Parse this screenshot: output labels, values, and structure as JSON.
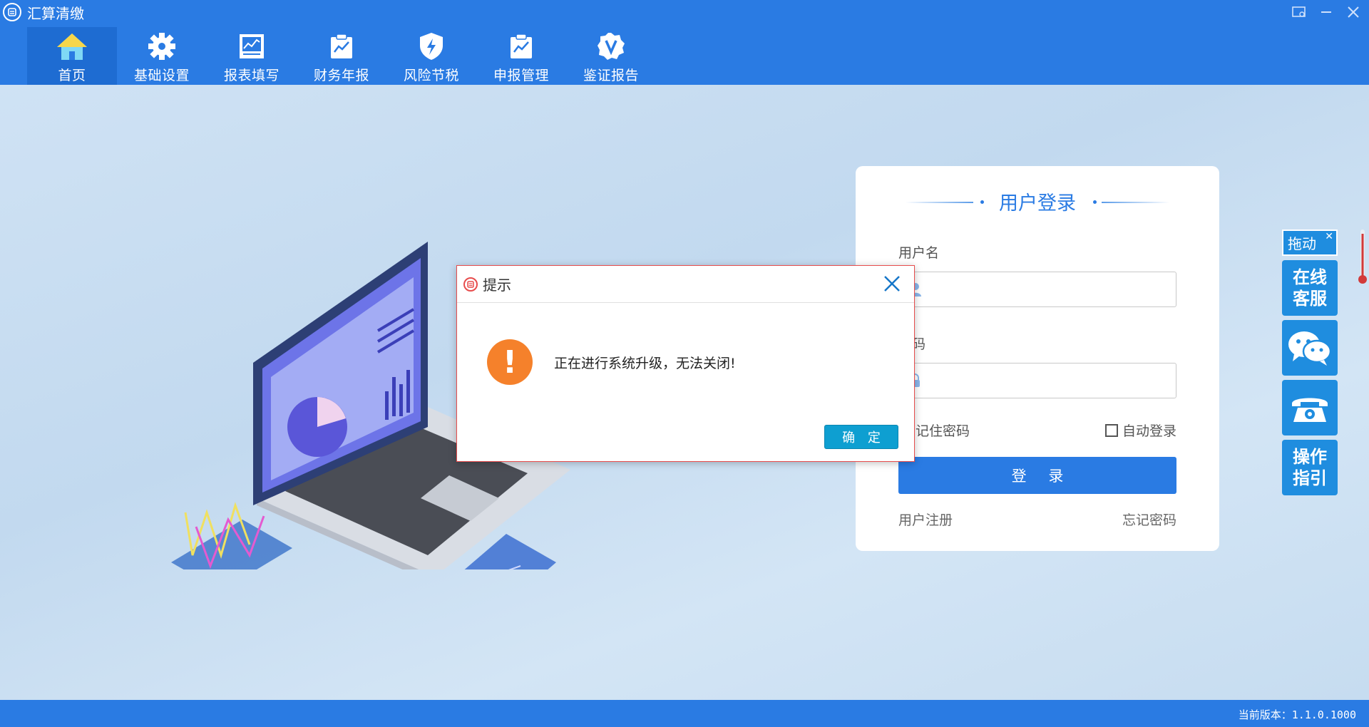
{
  "app": {
    "title": "汇算清缴"
  },
  "nav": {
    "items": [
      {
        "label": "首页",
        "icon": "home-icon"
      },
      {
        "label": "基础设置",
        "icon": "gear-icon"
      },
      {
        "label": "报表填写",
        "icon": "report-chart-icon"
      },
      {
        "label": "财务年报",
        "icon": "clipboard-chart-icon"
      },
      {
        "label": "风险节税",
        "icon": "shield-bolt-icon"
      },
      {
        "label": "申报管理",
        "icon": "clipboard-chart-icon"
      },
      {
        "label": "鉴证报告",
        "icon": "v-badge-icon"
      }
    ]
  },
  "login": {
    "title": "用户登录",
    "username_label": "用户名",
    "username_value": "",
    "password_label": "密码",
    "password_value": "",
    "remember_label": "记住密码",
    "auto_login_label": "自动登录",
    "submit_label": "登 录",
    "register_link": "用户注册",
    "forgot_link": "忘记密码"
  },
  "float_tools": {
    "drag_label": "拖动",
    "service_label": "在线\n客服",
    "guide_label": "操作\n指引"
  },
  "dialog": {
    "title": "提示",
    "message": "正在进行系统升级，无法关闭!",
    "ok_label": "确 定"
  },
  "status": {
    "version": "当前版本：1.1.0.1000"
  },
  "colors": {
    "brand": "#2a7be3",
    "warning": "#f5812b",
    "ok_button": "#0e9fd1",
    "tool": "#1f8ddf"
  }
}
